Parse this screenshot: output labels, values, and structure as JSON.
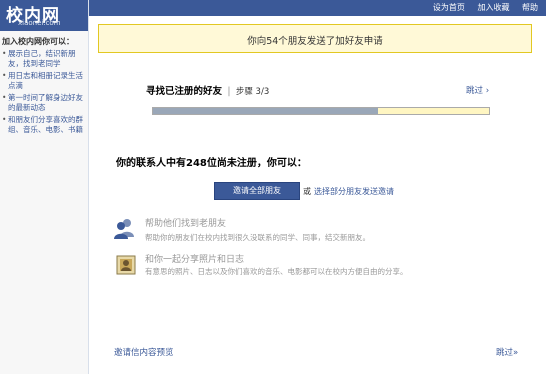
{
  "header": {
    "links": [
      "设为首页",
      "加入收藏",
      "帮助"
    ]
  },
  "logo": {
    "text": "校内网",
    "subtext": "xiaonei.com"
  },
  "sidebar": {
    "title": "加入校内网你可以：",
    "items": [
      "展示自己，结识新朋友，找到老同学",
      "用日志和相册记录生活点滴",
      "第一时间了解身边好友的最新动态",
      "和朋友们分享喜欢的群组、音乐、电影、书籍"
    ]
  },
  "notice": {
    "text": "你向54个朋友发送了加好友申请"
  },
  "step": {
    "title": "寻找已注册的好友",
    "separator": "|",
    "label": "步骤 3/3",
    "progress_completed_fraction": 0.67,
    "skip": "跳过 ›"
  },
  "contacts": {
    "message": "你的联系人中有248位尚未注册，你可以："
  },
  "actions": {
    "invite_all": "邀请全部朋友",
    "or": "或",
    "select_link": "选择部分朋友发送邀请"
  },
  "features": [
    {
      "icon": "users-icon",
      "title": "帮助他们找到老朋友",
      "desc": "帮助你的朋友们在校内找到很久没联系的同学、同事，结交新朋友。"
    },
    {
      "icon": "photo-icon",
      "title": "和你一起分享照片和日志",
      "desc": "有意思的照片、日志以及你们喜欢的音乐、电影都可以在校内方便自由的分享。"
    }
  ],
  "footer": {
    "preview_link": "邀请信内容预览",
    "skip": "跳过»"
  },
  "colors": {
    "brand": "#3b5998",
    "notice_bg": "#fff9d7",
    "notice_border": "#e2c822"
  }
}
